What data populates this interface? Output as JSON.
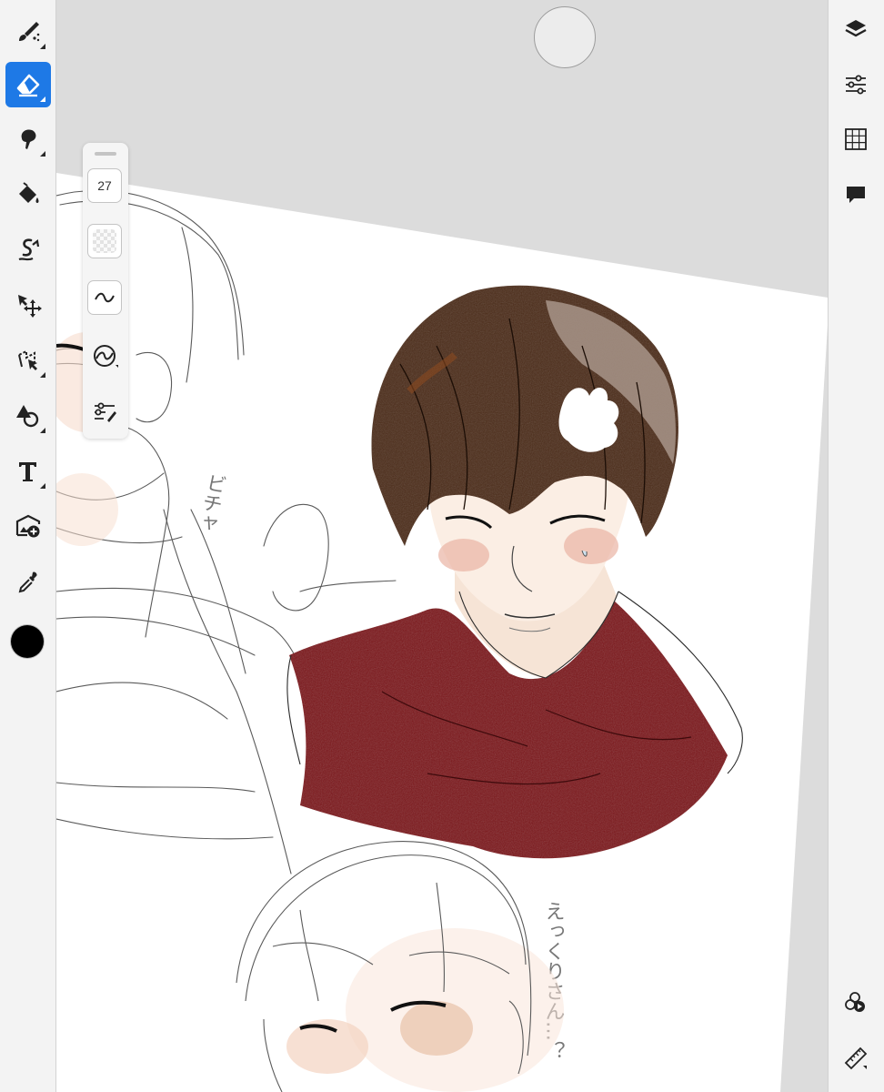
{
  "brush_panel": {
    "size_value": "27"
  },
  "left_tools": [
    "brush-tool",
    "eraser-tool",
    "smudge-tool",
    "fill-tool",
    "liquify-tool",
    "transform-tool",
    "selection-tool",
    "shape-tool",
    "text-tool",
    "image-import-tool",
    "eyedropper-tool"
  ],
  "active_tool": "eraser-tool",
  "colors": {
    "accent": "#1e79e6",
    "current_color": "#000000",
    "scarf": "#7a1418",
    "hair": "#4a2a17"
  },
  "canvas_text": {
    "sketch_note_1": "ビチャ",
    "sketch_note_2": "えっくりさん…？"
  }
}
